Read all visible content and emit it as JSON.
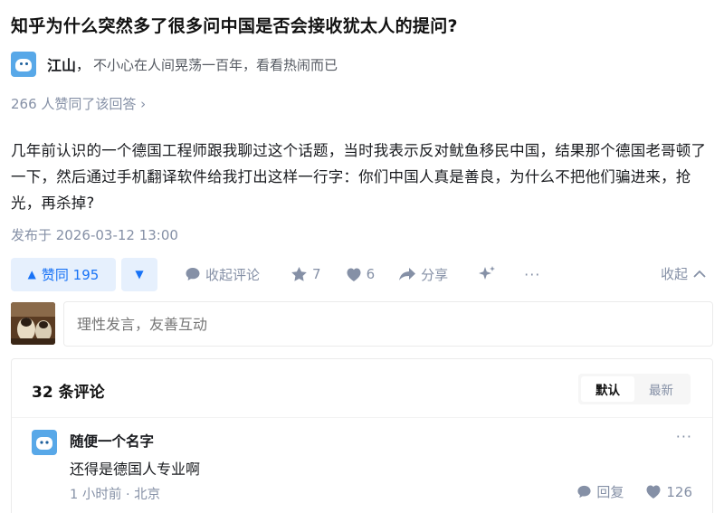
{
  "question": {
    "title": "知乎为什么突然多了很多问中国是否会接收犹太人的提问?"
  },
  "author": {
    "name": "江山",
    "separator": "，",
    "bio": "不小心在人间晃荡一百年，看看热闹而已",
    "avatar_icon": "blue-cartoon-avatar"
  },
  "answer": {
    "upvote_summary": "266 人赞同了该回答 ›",
    "content": "几年前认识的一个德国工程师跟我聊过这个话题，当时我表示反对鱿鱼移民中国，结果那个德国老哥顿了一下，然后通过手机翻译软件给我打出这样一行字：你们中国人真是善良，为什么不把他们骗进来，抢光，再杀掉?",
    "publish_time": "发布于 2026-03-12 13:00"
  },
  "actions": {
    "upvote_label": "赞同 195",
    "downvote_icon": "triangle-down-icon",
    "collapse_comments_label": "收起评论",
    "star_count": "7",
    "like_count": "6",
    "share_label": "分享",
    "more_icon": "ellipsis-icon",
    "collapse_label": "收起"
  },
  "comment_editor": {
    "placeholder": "理性发言，友善互动"
  },
  "comments": {
    "count_label": "32 条评论",
    "sort_default": "默认",
    "sort_latest": "最新",
    "items": [
      {
        "author": "随便一个名字",
        "text": "还得是德国人专业啊",
        "meta": "1 小时前 · 北京",
        "reply_label": "回复",
        "like_count": "126",
        "more": "···"
      }
    ]
  },
  "colors": {
    "accent": "#1772f6",
    "accent_bg": "#e6f0fd",
    "muted": "#8590a6",
    "avatar_blue": "#58a8e8"
  }
}
